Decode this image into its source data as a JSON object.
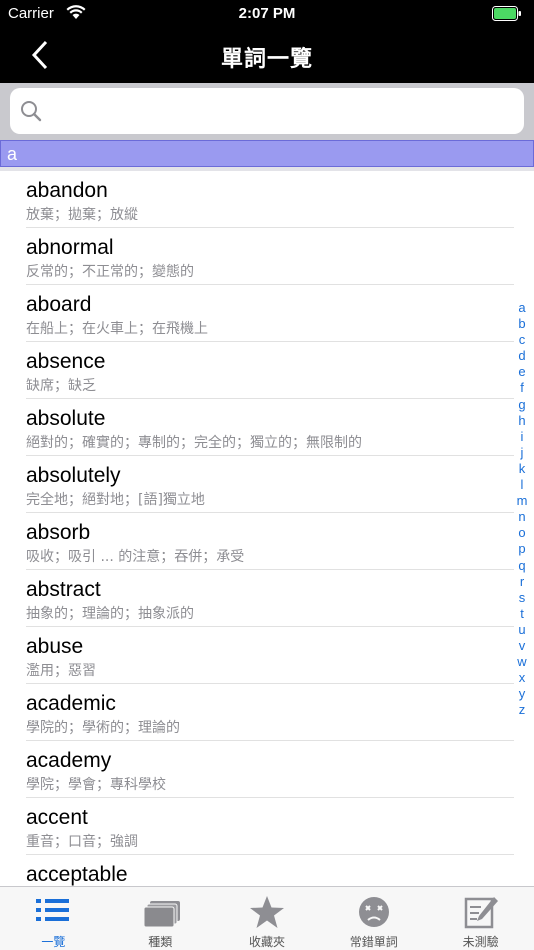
{
  "status": {
    "carrier": "Carrier",
    "time": "2:07 PM"
  },
  "nav": {
    "title": "單詞一覽"
  },
  "search": {
    "placeholder": "",
    "value": ""
  },
  "section": {
    "label": "a"
  },
  "words": [
    {
      "word": "abandon",
      "meaning": "放棄；拋棄；放縱"
    },
    {
      "word": "abnormal",
      "meaning": "反常的；不正常的；變態的"
    },
    {
      "word": "aboard",
      "meaning": "在船上；在火車上；在飛機上"
    },
    {
      "word": "absence",
      "meaning": "缺席；缺乏"
    },
    {
      "word": "absolute",
      "meaning": "絕對的；確實的；專制的；完全的；獨立的；無限制的"
    },
    {
      "word": "absolutely",
      "meaning": "完全地；絕對地；[語]獨立地"
    },
    {
      "word": "absorb",
      "meaning": "吸收；吸引 ... 的注意；吞併；承受"
    },
    {
      "word": "abstract",
      "meaning": "抽象的；理論的；抽象派的"
    },
    {
      "word": "abuse",
      "meaning": "濫用；惡習"
    },
    {
      "word": "academic",
      "meaning": "學院的；學術的；理論的"
    },
    {
      "word": "academy",
      "meaning": "學院；學會；專科學校"
    },
    {
      "word": "accent",
      "meaning": "重音；口音；強調"
    },
    {
      "word": "acceptable",
      "meaning": ""
    }
  ],
  "index": [
    "a",
    "b",
    "c",
    "d",
    "e",
    "f",
    "g",
    "h",
    "i",
    "j",
    "k",
    "l",
    "m",
    "n",
    "o",
    "p",
    "q",
    "r",
    "s",
    "t",
    "u",
    "v",
    "w",
    "x",
    "y",
    "z"
  ],
  "tabs": [
    {
      "label": "一覽",
      "icon": "list-icon",
      "active": true
    },
    {
      "label": "種類",
      "icon": "cards-icon",
      "active": false
    },
    {
      "label": "收藏夾",
      "icon": "star-icon",
      "active": false
    },
    {
      "label": "常錯單詞",
      "icon": "dizzy-face-icon",
      "active": false
    },
    {
      "label": "未測驗",
      "icon": "pencil-note-icon",
      "active": false
    }
  ],
  "colors": {
    "accent": "#1a6fd8",
    "section_bg": "#9a9af0",
    "nav_bg": "#000000"
  }
}
